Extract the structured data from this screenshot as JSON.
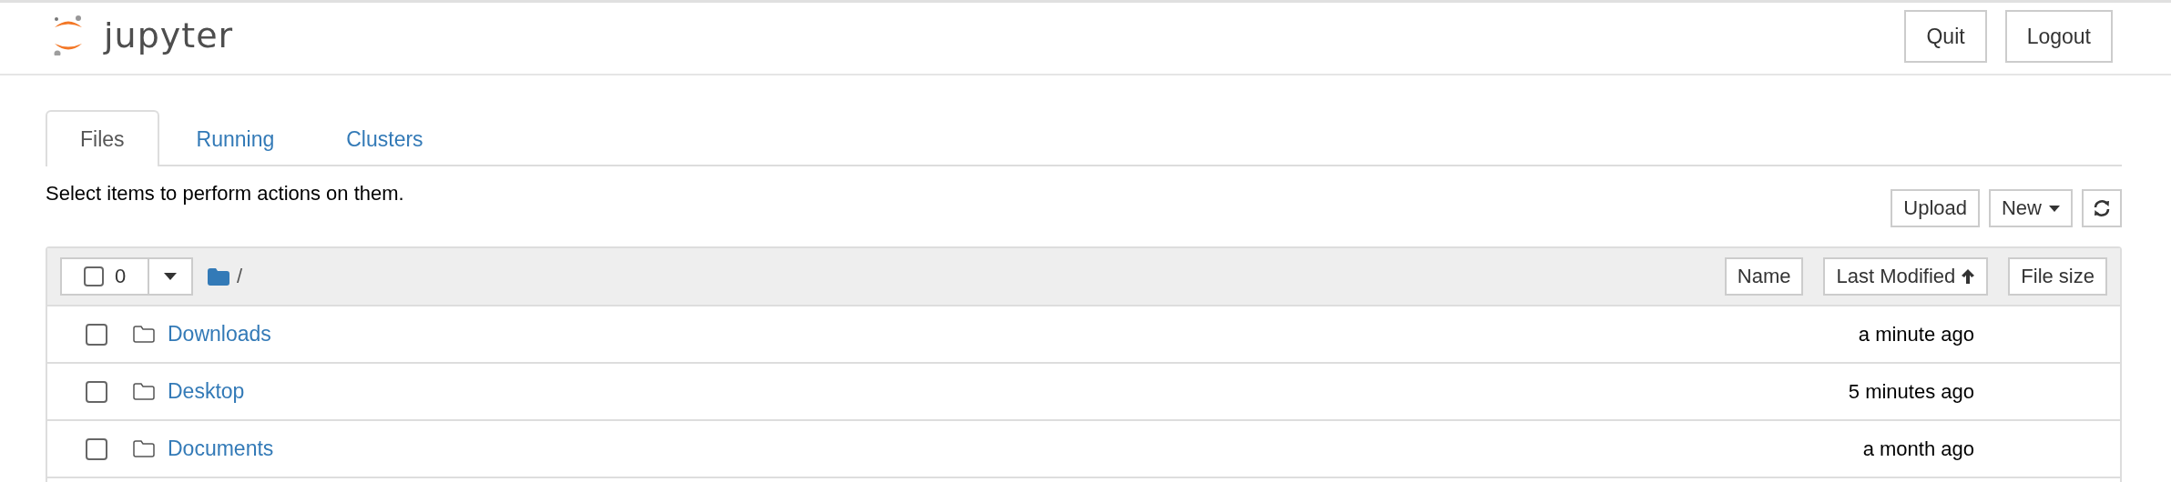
{
  "header": {
    "logo_text": "jupyter",
    "buttons": [
      "Quit",
      "Logout"
    ]
  },
  "tabs": [
    {
      "label": "Files",
      "selected": true
    },
    {
      "label": "Running",
      "selected": false
    },
    {
      "label": "Clusters",
      "selected": false
    }
  ],
  "hint": "Select items to perform actions on them.",
  "toolbar": {
    "upload": "Upload",
    "new": "New"
  },
  "list_header": {
    "selected_count": "0",
    "select_all_checked": false,
    "path": "/",
    "sort_buttons": [
      {
        "label": "Name",
        "sorted": false
      },
      {
        "label": "Last Modified",
        "sorted": true
      },
      {
        "label": "File size",
        "sorted": false
      }
    ]
  },
  "rows": [
    {
      "kind": "folder",
      "name": "Downloads",
      "modified": "a minute ago",
      "checked": false
    },
    {
      "kind": "folder",
      "name": "Desktop",
      "modified": "5 minutes ago",
      "checked": false
    },
    {
      "kind": "folder",
      "name": "Documents",
      "modified": "a month ago",
      "checked": false
    }
  ]
}
